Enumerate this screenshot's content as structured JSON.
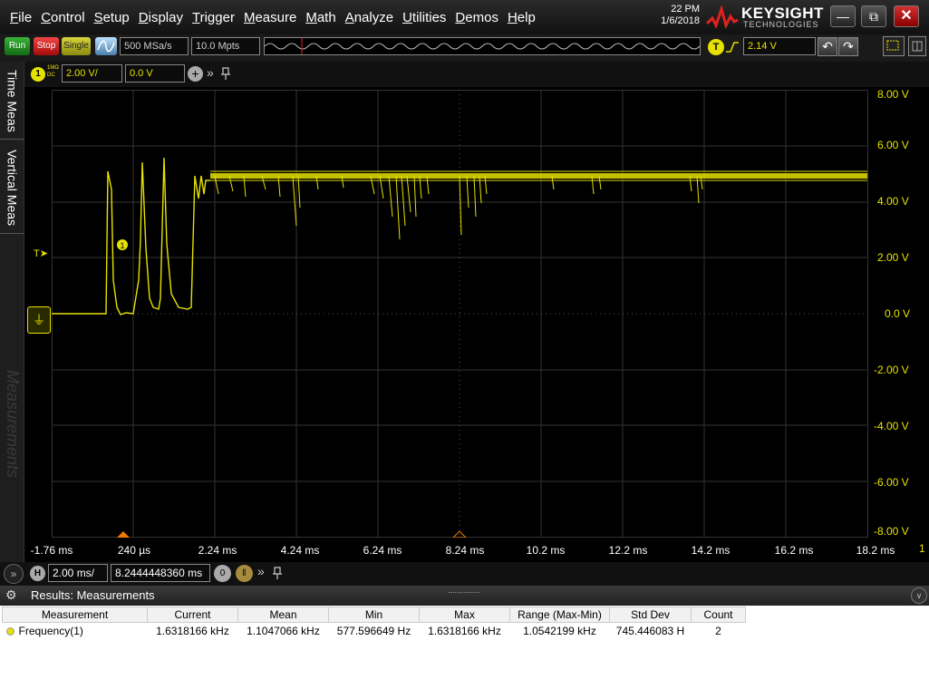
{
  "menu": [
    "File",
    "Control",
    "Setup",
    "Display",
    "Trigger",
    "Measure",
    "Math",
    "Analyze",
    "Utilities",
    "Demos",
    "Help"
  ],
  "clock": {
    "time": "22 PM",
    "date": "1/6/2018"
  },
  "brand": {
    "name": "KEYSIGHT",
    "sub": "TECHNOLOGIES"
  },
  "window": {
    "minimize": "—",
    "restore": "⧉",
    "close": "✕"
  },
  "toolbar": {
    "run": "Run",
    "stop": "Stop",
    "single": "Single",
    "sample_rate": "500 MSa/s",
    "memory_depth": "10.0 Mpts",
    "trigger_icon": "T",
    "trigger_level": "2.14 V",
    "undo": "↶",
    "redo": "↷"
  },
  "channel": {
    "icon": "1",
    "coupling_1": "1MΩ",
    "coupling_2": "DC",
    "scale": "2.00 V/",
    "offset": "0.0 V",
    "add": "+",
    "more": "»"
  },
  "side_tabs": {
    "time_meas": "Time Meas",
    "vertical_meas": "Vertical Meas",
    "measurements": "Measurements"
  },
  "y_labels": [
    "8.00 V",
    "6.00 V",
    "4.00 V",
    "2.00 V",
    "0.0 V",
    "-2.00 V",
    "-4.00 V",
    "-6.00 V",
    "-8.00 V"
  ],
  "x_labels": [
    "-1.76 ms",
    "240 µs",
    "2.24 ms",
    "4.24 ms",
    "6.24 ms",
    "8.24 ms",
    "10.2 ms",
    "12.2 ms",
    "14.2 ms",
    "16.2 ms",
    "18.2 ms"
  ],
  "ground_marker": "⏚",
  "trigger_marker": "T➤",
  "waveform_marker": "1",
  "page_number": "1",
  "horizontal": {
    "expand": "»",
    "icon": "H",
    "scale": "2.00 ms/",
    "position": "8.2444448360 ms",
    "zero": "0",
    "delay": "‖",
    "more": "»"
  },
  "results": {
    "title": "Results: Measurements",
    "gear": "⚙",
    "collapse": "∨",
    "columns": [
      "Measurement",
      "Current",
      "Mean",
      "Min",
      "Max",
      "Range (Max-Min)",
      "Std Dev",
      "Count"
    ],
    "rows": [
      [
        "Frequency(1)",
        "1.6318166 kHz",
        "1.1047066 kHz",
        "577.596649 Hz",
        "1.6318166 kHz",
        "1.0542199 kHz",
        "745.446083 H",
        "2"
      ]
    ]
  },
  "colors": {
    "channel1": "#e6e200",
    "grid": "#333333",
    "background": "#000000"
  }
}
